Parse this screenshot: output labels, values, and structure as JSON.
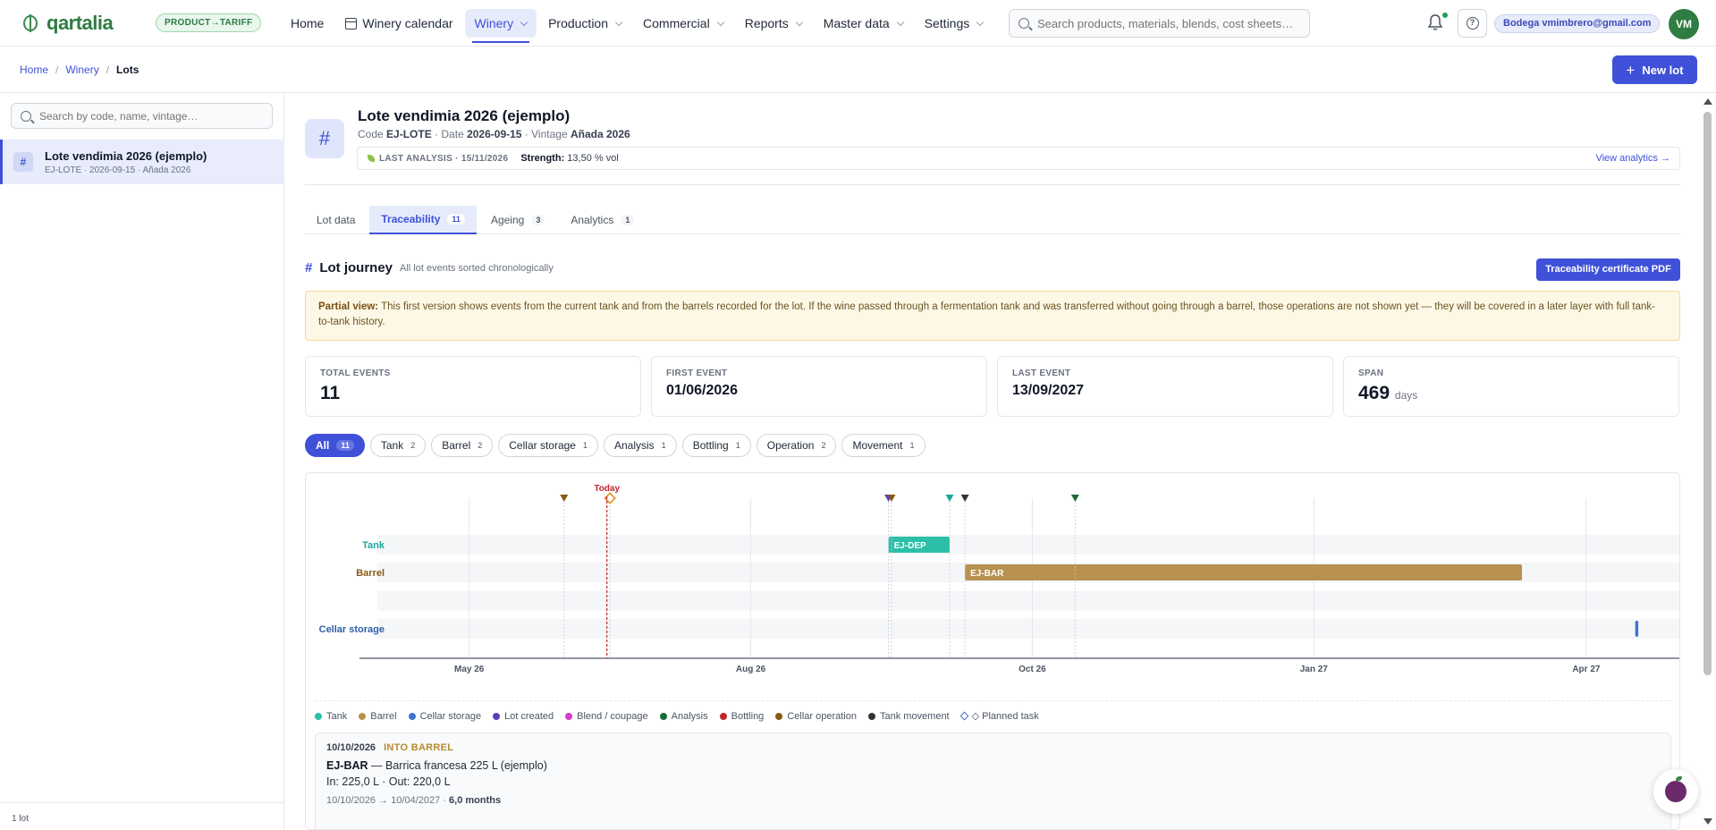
{
  "app": {
    "brand": "qartalia",
    "tariff": "PRODUCT→TARIFF",
    "user": "Bodega vmimbrero@gmail.com",
    "avatar_initials": "VM",
    "search_placeholder": "Search products, materials, blends, cost sheets…"
  },
  "nav": [
    {
      "label": "Home",
      "dropdown": false
    },
    {
      "label": "Winery calendar",
      "dropdown": false,
      "icon": "calendar-icon"
    },
    {
      "label": "Winery",
      "dropdown": true,
      "active": true
    },
    {
      "label": "Production",
      "dropdown": true
    },
    {
      "label": "Commercial",
      "dropdown": true
    },
    {
      "label": "Reports",
      "dropdown": true
    },
    {
      "label": "Master data",
      "dropdown": true
    },
    {
      "label": "Settings",
      "dropdown": true
    }
  ],
  "breadcrumb": [
    "Home",
    "Winery",
    "Lots"
  ],
  "new_lot_label": "New lot",
  "sidebar": {
    "search_placeholder": "Search by code, name, vintage…",
    "lot": {
      "name": "Lote vendimia 2026 (ejemplo)",
      "sub": "EJ-LOTE · 2026-09-15 · Añada 2026"
    },
    "footer": "1 lot"
  },
  "lot": {
    "title": "Lote vendimia 2026 (ejemplo)",
    "code_label": "Code",
    "code": "EJ-LOTE",
    "date_label": "Date",
    "date": "2026-09-15",
    "vintage_label": "Vintage",
    "vintage": "Añada 2026",
    "last_analysis": "LAST ANALYSIS · 15/11/2026",
    "strength_label": "Strength:",
    "strength": "13,50 % vol",
    "view_analytics": "View analytics →"
  },
  "tabs": [
    {
      "label": "Lot data",
      "count": ""
    },
    {
      "label": "Traceability",
      "count": "11",
      "active": true
    },
    {
      "label": "Ageing",
      "count": "3"
    },
    {
      "label": "Analytics",
      "count": "1"
    }
  ],
  "journey": {
    "title": "Lot journey",
    "subtitle": "All lot events sorted chronologically",
    "cert_button": "Traceability certificate PDF",
    "notice_bold": "Partial view:",
    "notice_text": "This first version shows events from the current tank and from the barrels recorded for the lot. If the wine passed through a fermentation tank and was transferred without going through a barrel, those operations are not shown yet — they will be covered in a later layer with full tank-to-tank history."
  },
  "stats": [
    {
      "label": "TOTAL EVENTS",
      "value": "11",
      "unit": ""
    },
    {
      "label": "FIRST EVENT",
      "value": "01/06/2026",
      "unit": ""
    },
    {
      "label": "LAST EVENT",
      "value": "13/09/2027",
      "unit": ""
    },
    {
      "label": "SPAN",
      "value": "469",
      "unit": "days"
    }
  ],
  "filters": [
    {
      "label": "All",
      "count": "11",
      "active": true
    },
    {
      "label": "Tank",
      "count": "2"
    },
    {
      "label": "Barrel",
      "count": "2"
    },
    {
      "label": "Cellar storage",
      "count": "1"
    },
    {
      "label": "Analysis",
      "count": "1"
    },
    {
      "label": "Bottling",
      "count": "1"
    },
    {
      "label": "Operation",
      "count": "2"
    },
    {
      "label": "Movement",
      "count": "1"
    }
  ],
  "timeline": {
    "today_label": "Today",
    "today_date": "2026-06-15",
    "ticks": [
      {
        "label": "May 26",
        "date": "2026-05-01"
      },
      {
        "label": "Aug 26",
        "date": "2026-08-01"
      },
      {
        "label": "Oct 26",
        "date": "2026-11-01"
      },
      {
        "label": "Jan 27",
        "date": "2027-02-01"
      },
      {
        "label": "Apr 27",
        "date": "2027-05-01"
      }
    ],
    "rows": [
      {
        "label": "Tank",
        "color": "#1aa89a"
      },
      {
        "label": "Barrel",
        "color": "#8a5a12"
      },
      {
        "label": "",
        "color": ""
      },
      {
        "label": "Cellar storage",
        "color": "#2d5fa8"
      }
    ],
    "bars": [
      {
        "row": 0,
        "label": "EJ-DEP",
        "start": "2026-09-15",
        "end": "2026-10-05",
        "color": "#2bbfa8"
      },
      {
        "row": 1,
        "label": "EJ-BAR",
        "start": "2026-10-10",
        "end": "2027-04-10",
        "color": "#b8914f"
      },
      {
        "row": 3,
        "label": "",
        "start": "2027-05-17",
        "end": "2027-05-18",
        "color": "#3f73c9"
      }
    ],
    "markers": [
      {
        "date": "2026-06-01",
        "color": "#8a5a12",
        "shape": "triangle"
      },
      {
        "date": "2026-06-16",
        "color": "#e0891d",
        "shape": "diamond"
      },
      {
        "date": "2026-09-15",
        "color": "#5b3fb8",
        "shape": "triangle"
      },
      {
        "date": "2026-09-16",
        "color": "#8a5a12",
        "shape": "triangle"
      },
      {
        "date": "2026-10-05",
        "color": "#1aa89a",
        "shape": "triangle"
      },
      {
        "date": "2026-10-10",
        "color": "#333333",
        "shape": "triangle"
      },
      {
        "date": "2026-11-15",
        "color": "#1a6b3a",
        "shape": "triangle"
      }
    ]
  },
  "legend": [
    {
      "label": "Tank",
      "color": "#2bbfa8"
    },
    {
      "label": "Barrel",
      "color": "#b8914f"
    },
    {
      "label": "Cellar storage",
      "color": "#3f73c9"
    },
    {
      "label": "Lot created",
      "color": "#5b3fb8"
    },
    {
      "label": "Blend / coupage",
      "color": "#d63cc9"
    },
    {
      "label": "Analysis",
      "color": "#1a6b3a"
    },
    {
      "label": "Bottling",
      "color": "#c0262d"
    },
    {
      "label": "Cellar operation",
      "color": "#8a5a12"
    },
    {
      "label": "Tank movement",
      "color": "#333333"
    },
    {
      "label": "◇ Planned task",
      "color": "#3f73c9",
      "shape": "diamond"
    }
  ],
  "event": {
    "date": "10/10/2026",
    "type": "INTO BARREL",
    "code": "EJ-BAR",
    "desc": "— Barrica francesa 225 L (ejemplo)",
    "io": "In: 225,0 L · Out: 220,0 L",
    "range": "10/10/2026 → 10/04/2027 ·",
    "duration": "6,0 months"
  }
}
